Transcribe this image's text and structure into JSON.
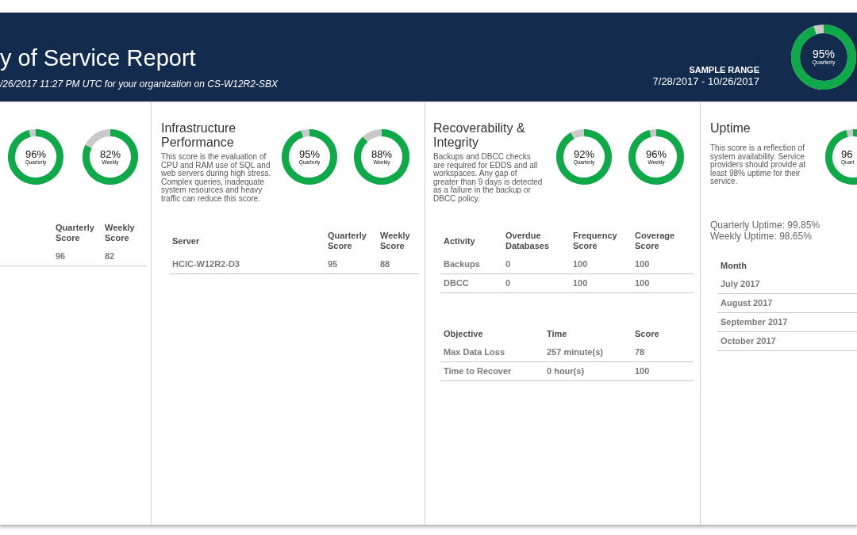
{
  "header": {
    "title": "y of Service Report",
    "subtitle": "/26/2017 11:27 PM UTC for your organization on CS-W12R2-SBX",
    "sample_range": {
      "label": "SAMPLE RANGE",
      "value": "7/28/2017 - 10/26/2017"
    },
    "gauge": {
      "value": "95%",
      "label": "Quarterly",
      "level": 0.95
    }
  },
  "panels": [
    {
      "gauges": [
        {
          "value": "96%",
          "label": "Quarterly",
          "level": 0.96
        },
        {
          "value": "82%",
          "label": "Weekly",
          "level": 0.82
        }
      ],
      "tables": [
        {
          "columns": [
            "Quarterly Score",
            "Weekly Score"
          ],
          "rows": [
            [
              "96",
              "82"
            ]
          ]
        }
      ]
    },
    {
      "title": "Infrastructure Performance",
      "description": "This score is the evaluation of CPU and RAM use of SQL and web servers during high stress. Complex queries, inadequate system resources and heavy traffic can reduce this score.",
      "gauges": [
        {
          "value": "95%",
          "label": "Quarterly",
          "level": 0.95
        },
        {
          "value": "88%",
          "label": "Weekly",
          "level": 0.88
        }
      ],
      "tables": [
        {
          "columns": [
            "Server",
            "Quarterly Score",
            "Weekly Score"
          ],
          "rows": [
            [
              "HCIC-W12R2-D3",
              "95",
              "88"
            ]
          ]
        }
      ]
    },
    {
      "title": "Recoverability & Integrity",
      "description": "Backups and DBCC checks are required for EDDS and all workspaces. Any gap of greater than 9 days is detected as a failure in the backup or DBCC policy.",
      "gauges": [
        {
          "value": "92%",
          "label": "Quarterly",
          "level": 0.92
        },
        {
          "value": "96%",
          "label": "Weekly",
          "level": 0.96
        }
      ],
      "tables": [
        {
          "columns": [
            "Activity",
            "Overdue Databases",
            "Frequency Score",
            "Coverage Score"
          ],
          "rows": [
            [
              "Backups",
              "0",
              "100",
              "100"
            ],
            [
              "DBCC",
              "0",
              "100",
              "100"
            ]
          ]
        },
        {
          "columns": [
            "Objective",
            "Time",
            "Score"
          ],
          "rows": [
            [
              "Max Data Loss",
              "257 minute(s)",
              "78"
            ],
            [
              "Time to Recover",
              "0 hour(s)",
              "100"
            ]
          ]
        }
      ]
    },
    {
      "title": "Uptime",
      "description": "This score is a reflection of system availability. Service providers should provide at least 98% uptime for their service.",
      "gauges": [
        {
          "value": "96",
          "label": "Quart",
          "level": 0.96
        }
      ],
      "uptime_lines": [
        "Quarterly Uptime: 99.85%",
        "Weekly Uptime: 98.65%"
      ],
      "tables": [
        {
          "columns": [
            "Month"
          ],
          "rows": [
            [
              "July 2017"
            ],
            [
              "August 2017"
            ],
            [
              "September 2017"
            ],
            [
              "October 2017"
            ]
          ]
        }
      ]
    }
  ]
}
